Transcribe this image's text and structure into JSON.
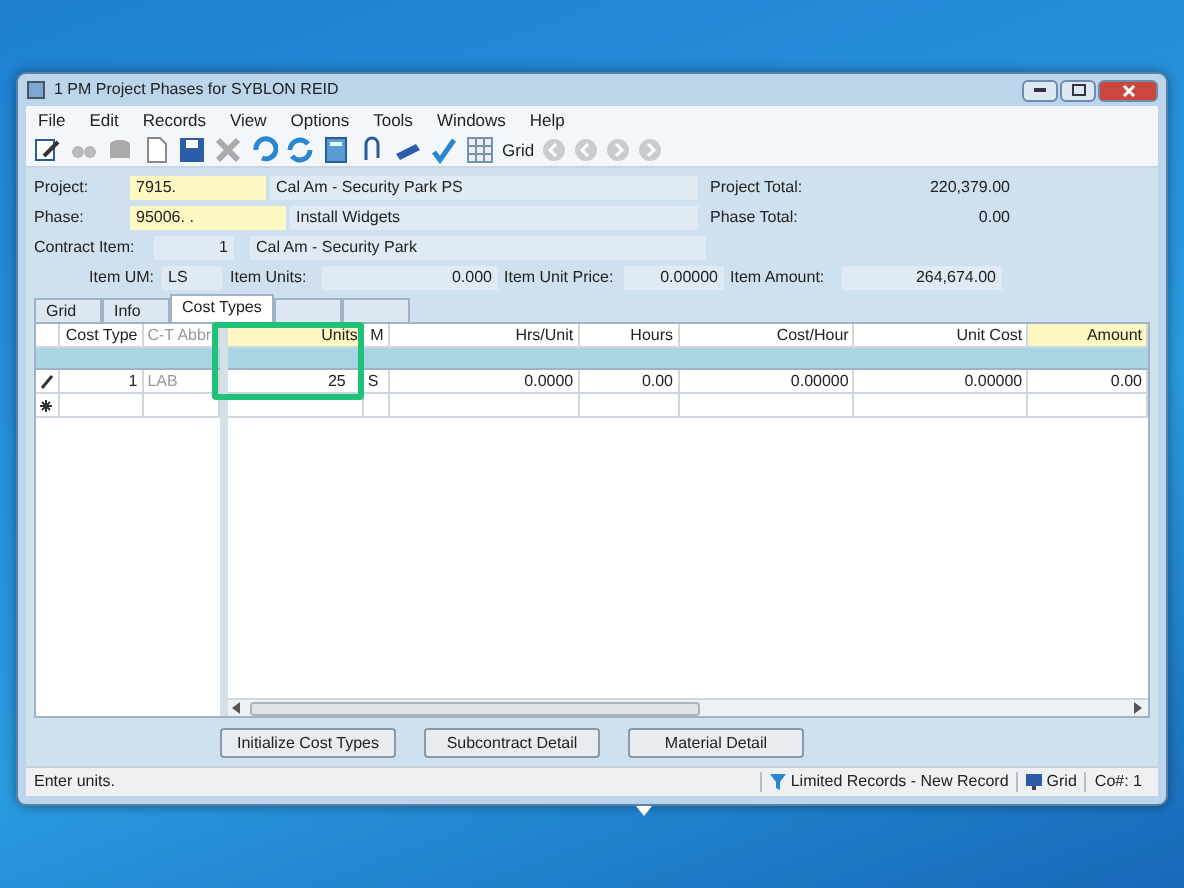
{
  "window": {
    "title": "1 PM Project Phases for SYBLON REID"
  },
  "menu": [
    "File",
    "Edit",
    "Records",
    "View",
    "Options",
    "Tools",
    "Windows",
    "Help"
  ],
  "toolbar": {
    "view_label": "Grid"
  },
  "header": {
    "project_label": "Project:",
    "project": "7915.",
    "project_desc": "Cal Am - Security Park PS",
    "project_total_label": "Project Total:",
    "project_total": "220,379.00",
    "phase_label": "Phase:",
    "phase": "95006.  .",
    "phase_desc": "Install Widgets",
    "phase_total_label": "Phase Total:",
    "phase_total": "0.00",
    "contract_item_label": "Contract Item:",
    "contract_item": "1",
    "contract_item_desc": "Cal Am - Security Park",
    "item_um_label": "Item UM:",
    "item_um": "LS",
    "item_units_label": "Item Units:",
    "item_units": "0.000",
    "item_unit_price_label": "Item Unit Price:",
    "item_unit_price": "0.00000",
    "item_amount_label": "Item Amount:",
    "item_amount": "264,674.00"
  },
  "tabs": [
    {
      "label": "Grid",
      "selected": false
    },
    {
      "label": "Info",
      "selected": false
    },
    {
      "label": "Cost Types",
      "selected": true
    },
    {
      "selected": false
    },
    {
      "selected": false
    }
  ],
  "left_grid": {
    "columns": [
      {
        "label": "Cost Type",
        "dim": false
      },
      {
        "label": "C-T Abbr",
        "dim": true
      }
    ],
    "rows": [
      {
        "kind": "editing",
        "cells": [
          "1",
          "LAB"
        ]
      },
      {
        "kind": "new",
        "cells": [
          "",
          ""
        ]
      }
    ]
  },
  "right_grid": {
    "columns": [
      {
        "label": "Units",
        "highlighted": true
      },
      {
        "label": "M",
        "highlighted": false
      },
      {
        "label": "Hrs/Unit",
        "highlighted": false
      },
      {
        "label": "Hours",
        "highlighted": false
      },
      {
        "label": "Cost/Hour",
        "highlighted": false
      },
      {
        "label": "Unit Cost",
        "highlighted": false
      },
      {
        "label": "Amount",
        "highlighted": true
      }
    ],
    "rows": [
      [
        "25",
        "S",
        "0.0000",
        "0.00",
        "0.00000",
        "0.00000",
        "0.00"
      ],
      [
        "",
        "",
        "",
        "",
        "",
        "",
        ""
      ]
    ]
  },
  "buttons": [
    "Initialize Cost Types",
    "Subcontract Detail",
    "Material Detail"
  ],
  "status_bar": {
    "message": "Enter units.",
    "records": "Limited Records - New Record",
    "view": "Grid",
    "company": "Co#: 1"
  }
}
